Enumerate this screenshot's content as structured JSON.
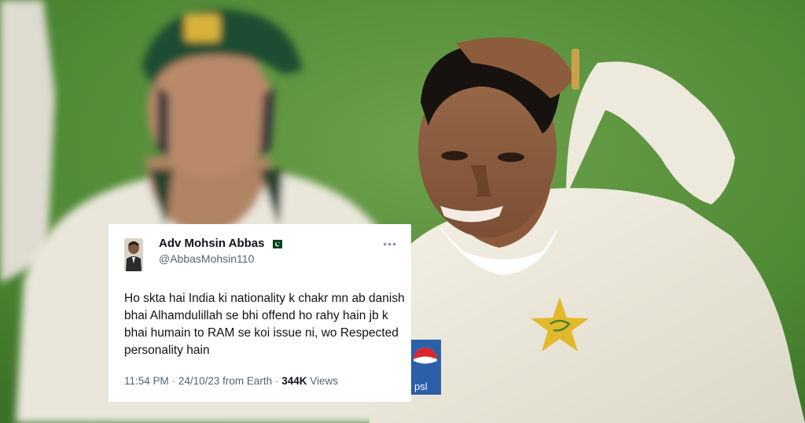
{
  "tweet": {
    "display_name": "Adv Mohsin Abbas",
    "handle": "@AbbasMohsin110",
    "flag_icon": "pakistan-flag",
    "more_icon": "ellipsis-icon",
    "text": "Ho skta hai India ki nationality k chakr mn ab danish bhai Alhamdulillah se bhi offend ho rahy hain jb k bhai humain to RAM se koi issue ni, wo Respected personality hain",
    "time": "11:54 PM",
    "date": "24/10/23",
    "source": "from Earth",
    "views_count": "344K",
    "views_label": "Views"
  },
  "photo": {
    "shirt_logo": "psl"
  },
  "colors": {
    "grass": "#4f8a35",
    "flag_green": "#01411c",
    "pak_star": "#e2b92c",
    "text_primary": "#0f1419",
    "text_secondary": "#536471"
  }
}
